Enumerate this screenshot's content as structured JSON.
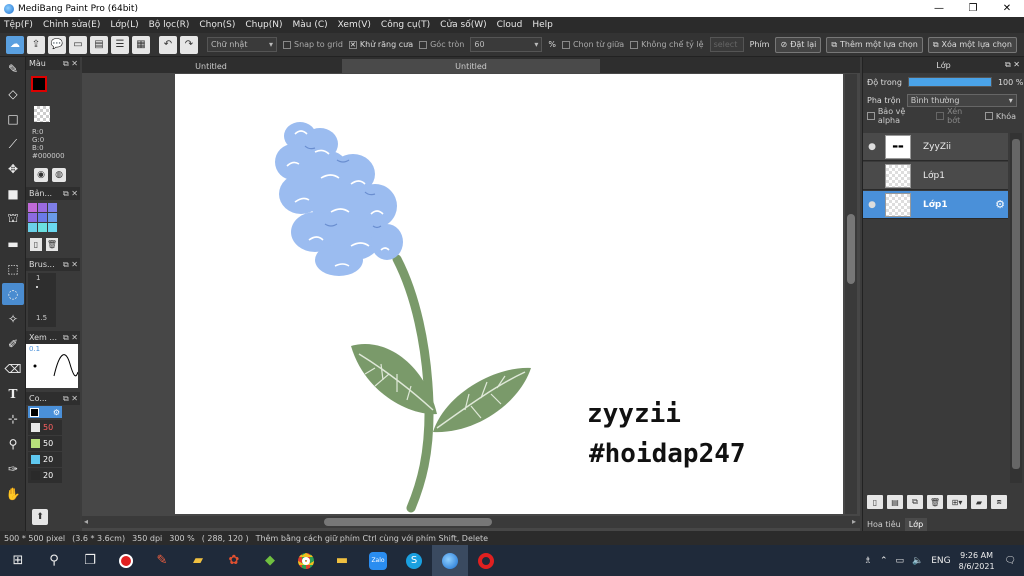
{
  "window": {
    "title": "MediBang Paint Pro (64bit)",
    "minimize": "—",
    "maximize": "❐",
    "close": "✕"
  },
  "menu": [
    "Tệp(F)",
    "Chỉnh sửa(E)",
    "Lớp(L)",
    "Bộ lọc(R)",
    "Chọn(S)",
    "Chụp(N)",
    "Màu (C)",
    "Xem(V)",
    "Công cụ(T)",
    "Cửa số(W)",
    "Cloud",
    "Help"
  ],
  "toolbar": {
    "shape_select": "Chữ nhật",
    "snap_to_grid": "Snap to grid",
    "antialias": "Khử răng cưa",
    "corner_round": "Góc tròn",
    "corner_value": "60",
    "percent": "%",
    "select_from_center": "Chọn từ giữa",
    "fix_ratio": "Không chế tỷ lệ",
    "ratio_value": "select",
    "keys_label": "Phím",
    "reset": "Đặt lại",
    "add_selection": "Thêm một lựa chọn",
    "remove_selection": "Xóa một lựa chọn"
  },
  "left_panels": {
    "color": {
      "title": "Màu",
      "r": "R:0",
      "g": "G:0",
      "b": "B:0",
      "hex": "#000000",
      "fg": "#000000"
    },
    "palette": {
      "title": "Bản..."
    },
    "brush": {
      "title": "Brus...",
      "size1": "1",
      "size2": "1.5"
    },
    "view": {
      "title": "Xem ...",
      "value": "0.1"
    },
    "colorset": {
      "title": "Co...",
      "rows": [
        {
          "value": "50",
          "color": "#e8e8e8",
          "text_color": "#ff6060"
        },
        {
          "value": "50",
          "color": "#b8e07a",
          "text_color": "#ffffff"
        },
        {
          "value": "20",
          "color": "#5fc8f0",
          "text_color": "#ffffff"
        },
        {
          "value": "20",
          "color": "#2a2a2a",
          "text_color": "#ffffff"
        }
      ]
    }
  },
  "tabs": [
    "Untitled",
    "Untitled"
  ],
  "canvas": {
    "signature_line1": "zyyzii",
    "signature_line2": "#hoidap247"
  },
  "layer_panel": {
    "title": "Lớp",
    "opacity_label": "Độ trong",
    "opacity_value": "100 %",
    "opacity_fraction": 1.0,
    "blend_label": "Pha trộn",
    "blend_value": "Bình thường",
    "protect_alpha": "Bảo vệ alpha",
    "clip": "Xén bớt",
    "lock": "Khóa",
    "layers": [
      {
        "name": "ZyyZii",
        "visible": true,
        "selected": false
      },
      {
        "name": "Lớp1",
        "visible": false,
        "selected": false
      },
      {
        "name": "Lớp1",
        "visible": true,
        "selected": true
      }
    ],
    "bottom_tabs": [
      "Hoa tiêu",
      "Lớp"
    ]
  },
  "status": {
    "size": "500 * 500 pixel",
    "cm": "(3.6 * 3.6cm)",
    "dpi": "350 dpi",
    "zoom": "300 %",
    "coords": "( 288, 120 )",
    "hint": "Thêm bằng cách giữ phím Ctrl cùng với phím Shift, Delete"
  },
  "taskbar": {
    "language": "ENG",
    "time": "9:26 AM",
    "date": "8/6/2021"
  },
  "colors": {
    "accent": "#4a90d9",
    "flower": "#9bbcf0",
    "leaf": "#7a9a6a"
  }
}
